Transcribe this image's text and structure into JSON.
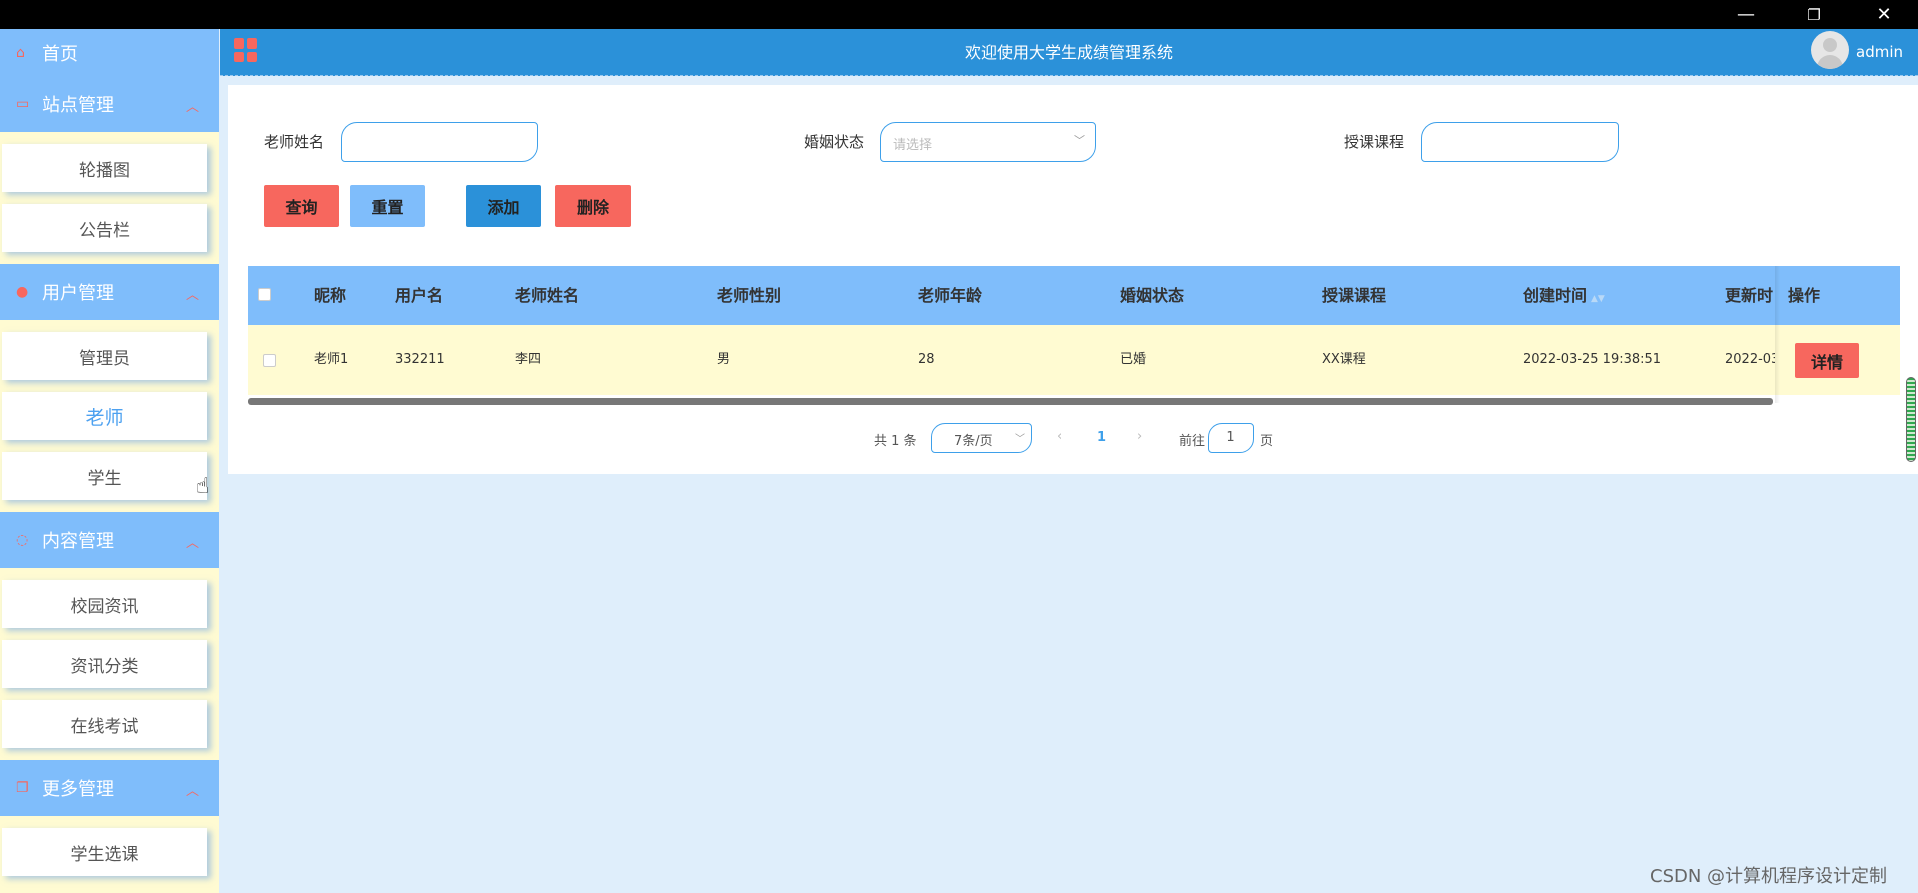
{
  "window": {
    "minimize": "—",
    "maximize": "❐",
    "close": "✕"
  },
  "sidebar": {
    "home": "首页",
    "groups": [
      {
        "title": "站点管理",
        "icon": "monitor-icon",
        "items": [
          "轮播图",
          "公告栏"
        ]
      },
      {
        "title": "用户管理",
        "icon": "user-icon",
        "items": [
          "管理员",
          "老师",
          "学生"
        ]
      },
      {
        "title": "内容管理",
        "icon": "chat-icon",
        "items": [
          "校园资讯",
          "资讯分类",
          "在线考试"
        ]
      },
      {
        "title": "更多管理",
        "icon": "copy-icon",
        "items": [
          "学生选课"
        ]
      }
    ],
    "active_item": "老师"
  },
  "header": {
    "title": "欢迎使用大学生成绩管理系统",
    "username": "admin"
  },
  "filters": {
    "teacher_name_label": "老师姓名",
    "teacher_name_value": "",
    "marital_label": "婚姻状态",
    "marital_placeholder": "请选择",
    "course_label": "授课课程",
    "course_value": ""
  },
  "buttons": {
    "query": "查询",
    "reset": "重置",
    "add": "添加",
    "delete": "删除",
    "detail": "详情"
  },
  "table": {
    "columns": [
      "昵称",
      "用户名",
      "老师姓名",
      "老师性别",
      "老师年龄",
      "婚姻状态",
      "授课课程",
      "创建时间",
      "更新时",
      "操作"
    ],
    "rows": [
      [
        "老师1",
        "332211",
        "李四",
        "男",
        "28",
        "已婚",
        "XX课程",
        "2022-03-25 19:38:51",
        "2022-03-"
      ]
    ]
  },
  "pagination": {
    "total": "共 1 条",
    "page_size": "7条/页",
    "current_page": "1",
    "goto_label": "前往",
    "goto_value": "1",
    "page_unit": "页"
  },
  "watermark": "CSDN @计算机程序设计定制",
  "colors": {
    "accent_red": "#f7675e",
    "light_blue": "#7fbdfb",
    "header_blue": "#2b91d9",
    "sidebar_bg": "#fffbd2",
    "content_bg": "#dfeefb"
  }
}
